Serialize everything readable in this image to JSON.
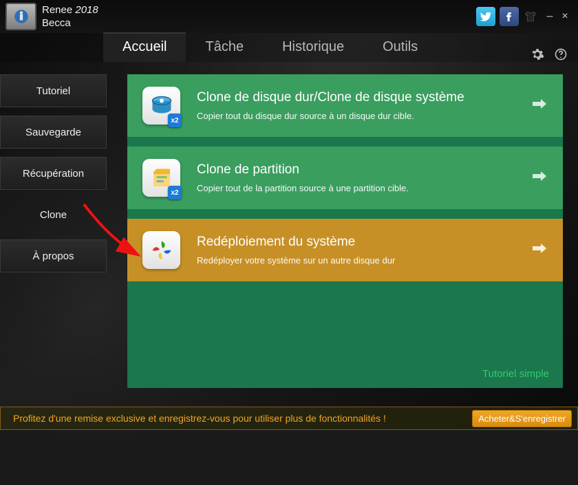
{
  "app": {
    "name_line1_a": "Renee ",
    "name_line1_b": "2018",
    "name_line2": "Becca"
  },
  "window_controls": {
    "minimize": "–",
    "close": "×"
  },
  "topnav": {
    "tabs": [
      {
        "label": "Accueil",
        "active": true
      },
      {
        "label": "Tâche",
        "active": false
      },
      {
        "label": "Historique",
        "active": false
      },
      {
        "label": "Outils",
        "active": false
      }
    ]
  },
  "sidebar": {
    "items": [
      {
        "label": "Tutoriel",
        "active": false
      },
      {
        "label": "Sauvegarde",
        "active": false
      },
      {
        "label": "Récupération",
        "active": false
      },
      {
        "label": "Clone",
        "active": true
      },
      {
        "label": "À propos",
        "active": false
      }
    ]
  },
  "icons": {
    "x2": "x2"
  },
  "options": [
    {
      "title": "Clone de disque dur/Clone de disque système",
      "desc": "Copier tout du disque dur source à un disque dur cible.",
      "highlight": false,
      "badge": "x2",
      "icon": "disk"
    },
    {
      "title": "Clone de partition",
      "desc": "Copier tout de la partition source à une partition cible.",
      "highlight": false,
      "badge": "x2",
      "icon": "partition"
    },
    {
      "title": "Redéploiement du système",
      "desc": "Redéployer votre système sur un autre disque dur",
      "highlight": true,
      "badge": null,
      "icon": "windows"
    }
  ],
  "panel": {
    "footer_link": "Tutoriel simple"
  },
  "promo": {
    "text": "Profitez d'une remise exclusive et enregistrez-vous pour utiliser plus de fonctionnalités !",
    "button": "Acheter&S'enregistrer"
  }
}
